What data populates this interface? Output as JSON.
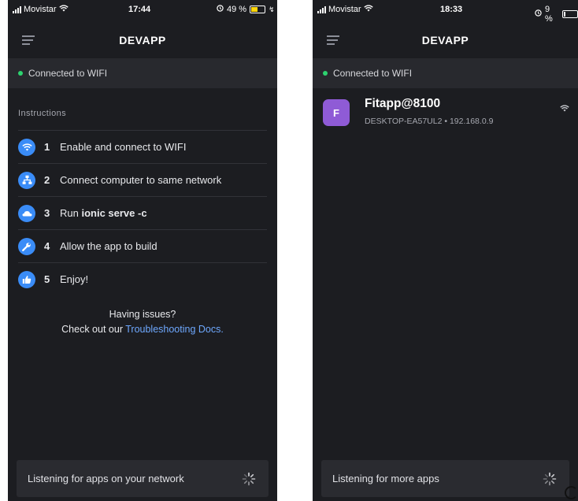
{
  "left": {
    "status": {
      "carrier": "Movistar",
      "time": "17:44",
      "battery": "49 %",
      "battery_level": 0.49
    },
    "nav": {
      "title": "DEVAPP",
      "menu_icon": "menu-icon"
    },
    "connection": {
      "text": "Connected to WIFI",
      "color": "#2dd36f"
    },
    "instructions_heading": "Instructions",
    "instructions": [
      {
        "num": "1",
        "icon": "wifi-icon",
        "text": "Enable and connect to WIFI"
      },
      {
        "num": "2",
        "icon": "network-icon",
        "text": "Connect computer to same network"
      },
      {
        "num": "3",
        "icon": "terminal-icon",
        "text_prefix": "Run ",
        "text_bold": "ionic serve -c"
      },
      {
        "num": "4",
        "icon": "wrench-icon",
        "text": "Allow the app to build"
      },
      {
        "num": "5",
        "icon": "thumbs-up-icon",
        "text": "Enjoy!"
      }
    ],
    "help": {
      "line1": "Having issues?",
      "line2_prefix": "Check out our ",
      "link": "Troubleshooting Docs."
    },
    "footer": {
      "text": "Listening for apps on your network"
    }
  },
  "right": {
    "status": {
      "carrier": "Movistar",
      "time": "18:33",
      "battery": "9 %",
      "battery_level": 0.09
    },
    "nav": {
      "title": "DEVAPP",
      "menu_icon": "menu-icon"
    },
    "connection": {
      "text": "Connected to WIFI",
      "color": "#2dd36f"
    },
    "app": {
      "avatar_letter": "F",
      "name": "Fitapp@8100",
      "subtitle": "DESKTOP-EA57UL2 • 192.168.0.9",
      "avatar_color": "#8f5bd6"
    },
    "footer": {
      "text": "Listening for more apps"
    }
  },
  "colors": {
    "background": "#1c1d21",
    "accent": "#3a8cf7",
    "link": "#6ea8fe"
  }
}
